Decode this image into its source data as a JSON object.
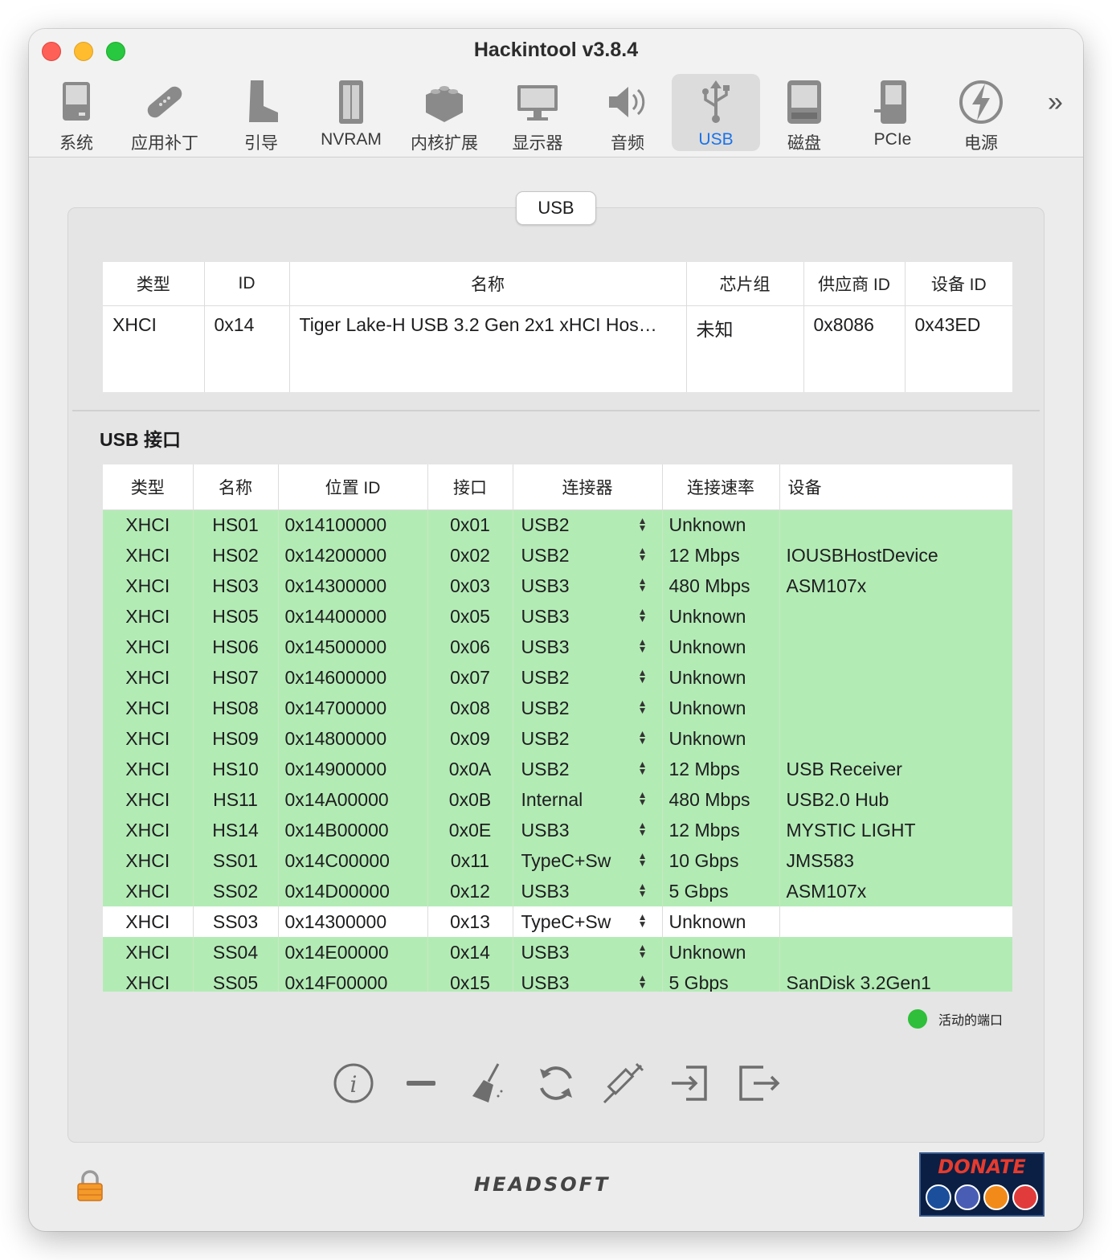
{
  "window": {
    "title": "Hackintool v3.8.4"
  },
  "toolbar": {
    "items": [
      {
        "label": "系统",
        "icon": "system-icon"
      },
      {
        "label": "应用补丁",
        "icon": "patch-icon"
      },
      {
        "label": "引导",
        "icon": "boot-icon"
      },
      {
        "label": "NVRAM",
        "icon": "nvram-icon"
      },
      {
        "label": "内核扩展",
        "icon": "kext-icon"
      },
      {
        "label": "显示器",
        "icon": "display-icon"
      },
      {
        "label": "音频",
        "icon": "audio-icon"
      },
      {
        "label": "USB",
        "icon": "usb-icon"
      },
      {
        "label": "磁盘",
        "icon": "disk-icon"
      },
      {
        "label": "PCIe",
        "icon": "pcie-icon"
      },
      {
        "label": "电源",
        "icon": "power-icon"
      }
    ],
    "active": "USB",
    "more": "»"
  },
  "segment": {
    "label": "USB"
  },
  "controllers": {
    "headers": [
      "类型",
      "ID",
      "名称",
      "芯片组",
      "供应商 ID",
      "设备 ID"
    ],
    "rows": [
      [
        "XHCI",
        "0x14",
        "Tiger Lake-H USB 3.2 Gen 2x1 xHCI Hos…",
        "未知",
        "0x8086",
        "0x43ED"
      ]
    ]
  },
  "ports": {
    "title": "USB 接口",
    "headers": [
      "类型",
      "名称",
      "位置 ID",
      "接口",
      "连接器",
      "连接速率",
      "设备"
    ],
    "rows": [
      {
        "type": "XHCI",
        "name": "HS01",
        "location": "0x14100000",
        "port": "0x01",
        "connector": "USB2",
        "speed": "Unknown",
        "device": "",
        "active": true
      },
      {
        "type": "XHCI",
        "name": "HS02",
        "location": "0x14200000",
        "port": "0x02",
        "connector": "USB2",
        "speed": "12 Mbps",
        "device": "IOUSBHostDevice",
        "active": true
      },
      {
        "type": "XHCI",
        "name": "HS03",
        "location": "0x14300000",
        "port": "0x03",
        "connector": "USB3",
        "speed": "480 Mbps",
        "device": "ASM107x",
        "active": true
      },
      {
        "type": "XHCI",
        "name": "HS05",
        "location": "0x14400000",
        "port": "0x05",
        "connector": "USB3",
        "speed": "Unknown",
        "device": "",
        "active": true
      },
      {
        "type": "XHCI",
        "name": "HS06",
        "location": "0x14500000",
        "port": "0x06",
        "connector": "USB3",
        "speed": "Unknown",
        "device": "",
        "active": true
      },
      {
        "type": "XHCI",
        "name": "HS07",
        "location": "0x14600000",
        "port": "0x07",
        "connector": "USB2",
        "speed": "Unknown",
        "device": "",
        "active": true
      },
      {
        "type": "XHCI",
        "name": "HS08",
        "location": "0x14700000",
        "port": "0x08",
        "connector": "USB2",
        "speed": "Unknown",
        "device": "",
        "active": true
      },
      {
        "type": "XHCI",
        "name": "HS09",
        "location": "0x14800000",
        "port": "0x09",
        "connector": "USB2",
        "speed": "Unknown",
        "device": "",
        "active": true
      },
      {
        "type": "XHCI",
        "name": "HS10",
        "location": "0x14900000",
        "port": "0x0A",
        "connector": "USB2",
        "speed": "12 Mbps",
        "device": "USB Receiver",
        "active": true
      },
      {
        "type": "XHCI",
        "name": "HS11",
        "location": "0x14A00000",
        "port": "0x0B",
        "connector": "Internal",
        "speed": "480 Mbps",
        "device": "USB2.0 Hub",
        "active": true
      },
      {
        "type": "XHCI",
        "name": "HS14",
        "location": "0x14B00000",
        "port": "0x0E",
        "connector": "USB3",
        "speed": "12 Mbps",
        "device": "MYSTIC LIGHT",
        "active": true
      },
      {
        "type": "XHCI",
        "name": "SS01",
        "location": "0x14C00000",
        "port": "0x11",
        "connector": "TypeC+Sw",
        "speed": "10 Gbps",
        "device": "JMS583",
        "active": true
      },
      {
        "type": "XHCI",
        "name": "SS02",
        "location": "0x14D00000",
        "port": "0x12",
        "connector": "USB3",
        "speed": "5 Gbps",
        "device": "ASM107x",
        "active": true
      },
      {
        "type": "XHCI",
        "name": "SS03",
        "location": "0x14300000",
        "port": "0x13",
        "connector": "TypeC+Sw",
        "speed": "Unknown",
        "device": "",
        "active": false
      },
      {
        "type": "XHCI",
        "name": "SS04",
        "location": "0x14E00000",
        "port": "0x14",
        "connector": "USB3",
        "speed": "Unknown",
        "device": "",
        "active": true
      },
      {
        "type": "XHCI",
        "name": "SS05",
        "location": "0x14F00000",
        "port": "0x15",
        "connector": "USB3",
        "speed": "5 Gbps",
        "device": "SanDisk 3.2Gen1",
        "active": true
      }
    ]
  },
  "legend": {
    "label": "活动的端口",
    "color": "#2fbf3a"
  },
  "actions": [
    "info-icon",
    "remove-icon",
    "clean-icon",
    "refresh-icon",
    "inject-icon",
    "import-icon",
    "export-icon"
  ],
  "footer": {
    "brand": "HEADSOFT",
    "donate": "DONATE"
  }
}
